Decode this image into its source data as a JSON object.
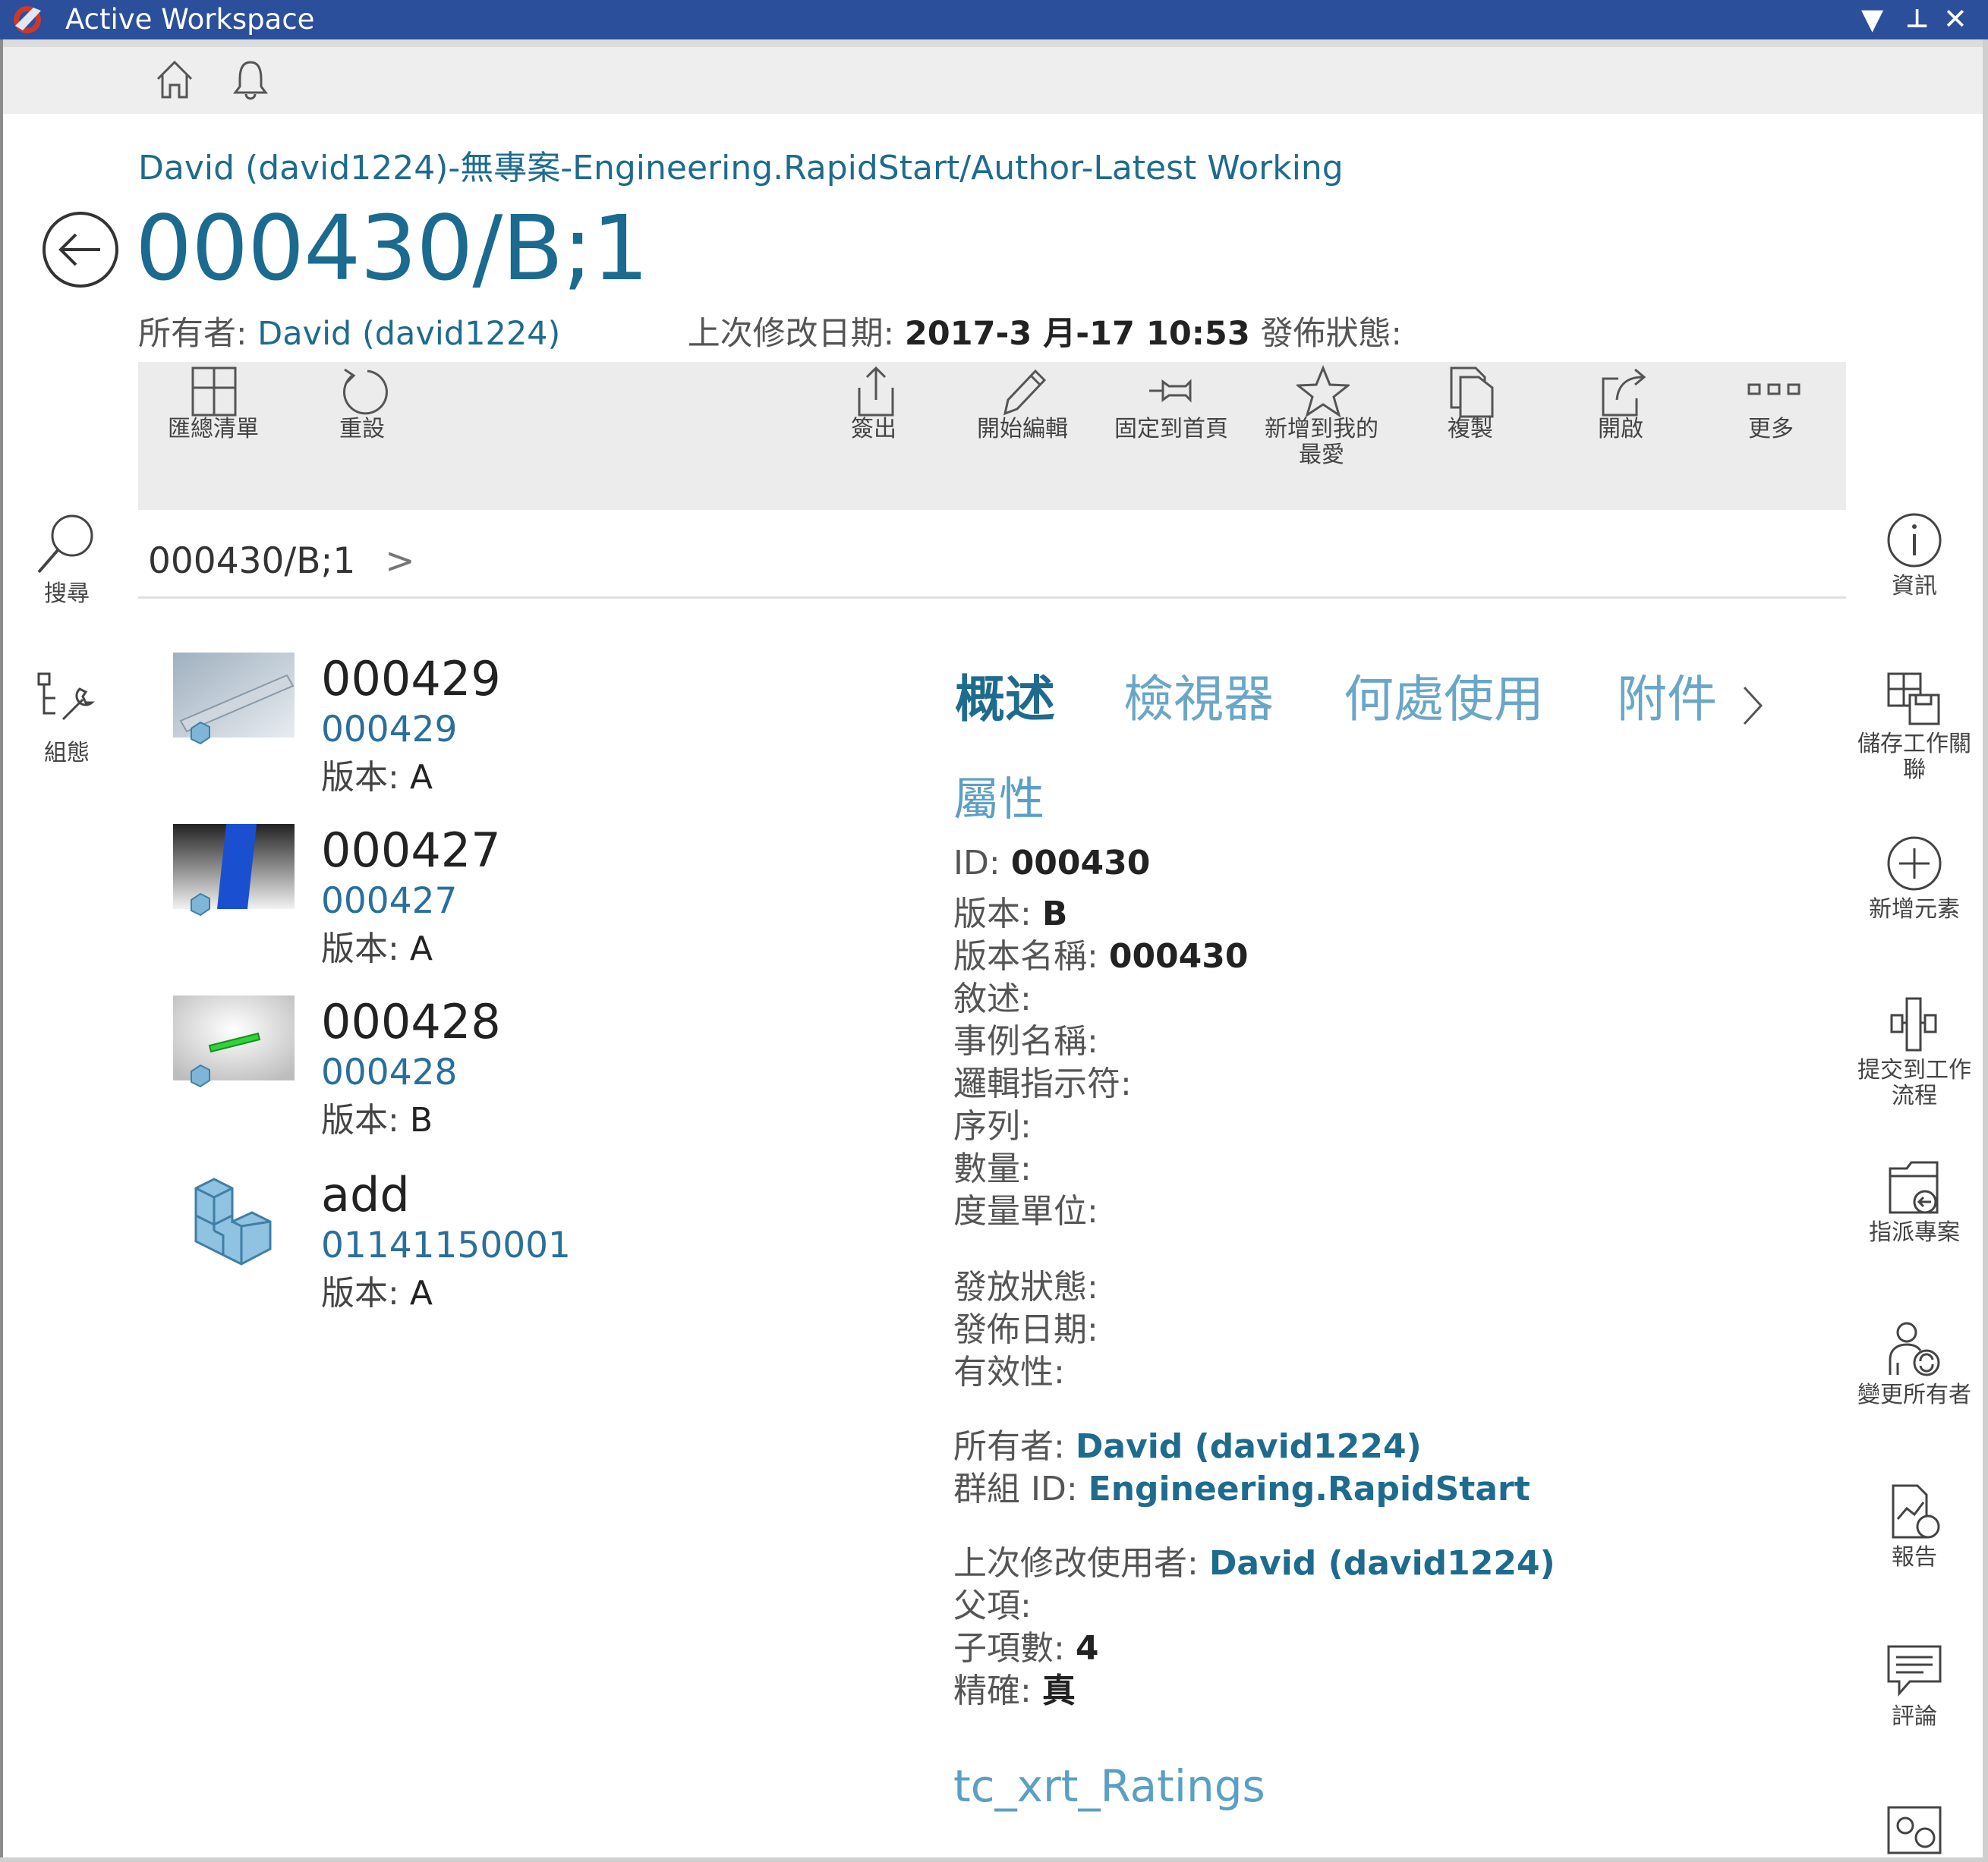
{
  "window": {
    "title": "Active Workspace",
    "controls": [
      "▼",
      "⊥",
      "✕"
    ]
  },
  "topbar": {
    "home_icon": "home-icon",
    "bell_icon": "bell-icon"
  },
  "header": {
    "breadcrumb": "David (david1224)-無專案-Engineering.RapidStart/Author-Latest Working",
    "title": "000430/B;1",
    "owner_label": "所有者:",
    "owner_value": "David (david1224)",
    "modified_label": "上次修改日期:",
    "modified_value": "2017-3 月-17 10:53",
    "release_label": "發佈狀態:"
  },
  "toolbar": {
    "items": [
      {
        "label": "匯總清單",
        "icon": "summary-list-icon"
      },
      {
        "label": "重設",
        "icon": "reset-icon"
      },
      {
        "label": "簽出",
        "icon": "checkout-icon"
      },
      {
        "label": "開始編輯",
        "icon": "edit-icon"
      },
      {
        "label": "固定到首頁",
        "icon": "pin-icon"
      },
      {
        "label": "新增到我的最愛",
        "icon": "star-icon"
      },
      {
        "label": "複製",
        "icon": "copy-icon"
      },
      {
        "label": "開啟",
        "icon": "open-icon"
      },
      {
        "label": "更多",
        "icon": "more-icon"
      }
    ]
  },
  "left_nav": {
    "search_label": "搜尋",
    "config_label": "組態"
  },
  "right_nav": {
    "items": [
      {
        "label": "資訊",
        "icon": "info-icon"
      },
      {
        "label": "儲存工作關聯",
        "icon": "save-context-icon"
      },
      {
        "label": "新增元素",
        "icon": "add-element-icon"
      },
      {
        "label": "提交到工作流程",
        "icon": "workflow-icon"
      },
      {
        "label": "指派專案",
        "icon": "assign-project-icon"
      },
      {
        "label": "變更所有者",
        "icon": "change-owner-icon"
      },
      {
        "label": "報告",
        "icon": "report-icon"
      },
      {
        "label": "評論",
        "icon": "comment-icon"
      }
    ]
  },
  "content": {
    "breadcrumb": "000430/B;1",
    "children": [
      {
        "name": "000429",
        "id": "000429",
        "rev_label": "版本:",
        "rev": "A"
      },
      {
        "name": "000427",
        "id": "000427",
        "rev_label": "版本:",
        "rev": "A"
      },
      {
        "name": "000428",
        "id": "000428",
        "rev_label": "版本:",
        "rev": "B"
      },
      {
        "name": "add",
        "id": "01141150001",
        "rev_label": "版本:",
        "rev": "A"
      }
    ]
  },
  "details": {
    "tabs": [
      "概述",
      "檢視器",
      "何處使用",
      "附件"
    ],
    "section_title": "屬性",
    "properties": [
      {
        "label": "ID:",
        "value": "000430"
      },
      {
        "label": "版本:",
        "value": "B"
      },
      {
        "label": "版本名稱:",
        "value": "000430"
      },
      {
        "label": "敘述:",
        "value": ""
      },
      {
        "label": "事例名稱:",
        "value": ""
      },
      {
        "label": "邏輯指示符:",
        "value": ""
      },
      {
        "label": "序列:",
        "value": ""
      },
      {
        "label": "數量:",
        "value": ""
      },
      {
        "label": "度量單位:",
        "value": ""
      },
      {
        "label": "發放狀態:",
        "value": ""
      },
      {
        "label": "發佈日期:",
        "value": ""
      },
      {
        "label": "有效性:",
        "value": ""
      },
      {
        "label": "所有者:",
        "value": "David (david1224)"
      },
      {
        "label": "群組 ID:",
        "value": "Engineering.RapidStart"
      },
      {
        "label": "上次修改使用者:",
        "value": "David (david1224)"
      },
      {
        "label": "父項:",
        "value": ""
      },
      {
        "label": "子項數:",
        "value": "4"
      },
      {
        "label": "精確:",
        "value": "真"
      }
    ],
    "ratings_title": "tc_xrt_Ratings"
  }
}
